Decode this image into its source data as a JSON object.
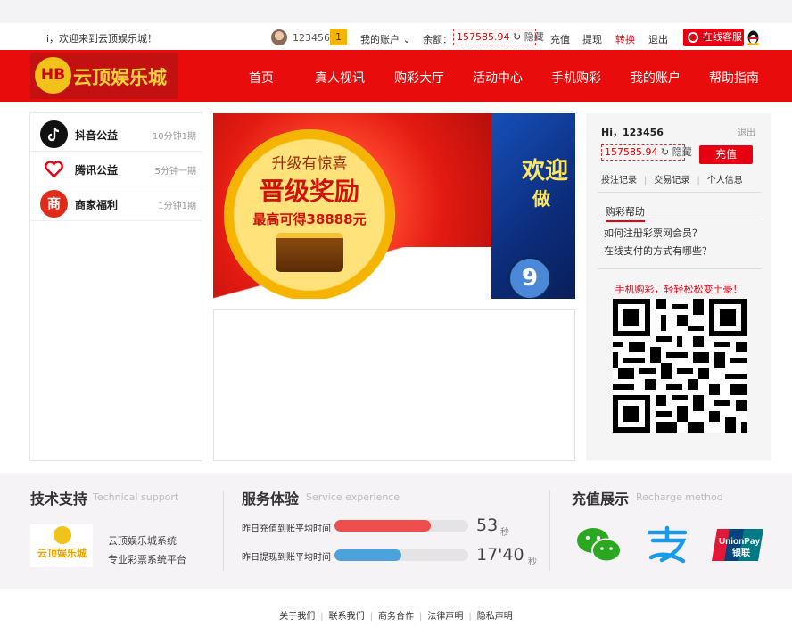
{
  "topbar": {
    "welcome": "i，欢迎来到云顶娱乐城！",
    "username": "123456",
    "level": "1",
    "my_account": "我的账户",
    "balance_label": "余额：",
    "balance": "157585.94",
    "hide": "隐藏",
    "links": [
      "充值",
      "提现",
      "转换",
      "退出"
    ],
    "online_service": "在线客服"
  },
  "nav": {
    "logo_mark": "HB",
    "logo_text": "云顶娱乐城",
    "items": [
      "首页",
      "真人视讯",
      "购彩大厅",
      "活动中心",
      "手机购彩",
      "我的账户",
      "帮助指南"
    ]
  },
  "lottery_list": [
    {
      "name": "抖音公益",
      "freq": "10分钟1期",
      "icon": "douyin-icon",
      "color": "#111111"
    },
    {
      "name": "腾讯公益",
      "freq": "5分钟一期",
      "icon": "heart-icon",
      "color": "#e60012"
    },
    {
      "name": "商家福利",
      "freq": "1分钟1期",
      "icon": "shang-icon",
      "color": "#e02a1a"
    }
  ],
  "banner": {
    "slide1_line1": "升级有惊喜",
    "slide1_line2": "晋级奖励",
    "slide1_line3": "最高可得38888元",
    "slide2_line1": "欢迎",
    "slide2_line2": "做",
    "slide2_ball": "9"
  },
  "account_panel": {
    "greeting": "Hi，123456",
    "logout": "退出",
    "balance": "157585.94",
    "hide": "隐藏",
    "recharge": "充值",
    "links": [
      "投注记录",
      "交易记录",
      "个人信息"
    ],
    "help_title": "购彩帮助",
    "faqs": [
      "如何注册彩票网会员？",
      "在线支付的方式有哪些？"
    ],
    "mobile_slogan": "手机购彩，轻轻松松变土豪！"
  },
  "footer_band": {
    "tech": {
      "title": "技术支持",
      "sub": "Technical support",
      "logo_text": "云顶娱乐城",
      "lines": [
        "云顶娱乐城系统",
        "专业彩票系统平台"
      ]
    },
    "service": {
      "title": "服务体验",
      "sub": "Service experience",
      "metrics": [
        {
          "label": "昨日充值到账平均时间",
          "value": "53",
          "unit": "秒",
          "fill": 0.72,
          "color": "#f04d4d"
        },
        {
          "label": "昨日提现到账平均时间",
          "value": "17'40",
          "unit": "秒",
          "fill": 0.5,
          "color": "#4aa3dc"
        }
      ]
    },
    "pay": {
      "title": "充值展示",
      "sub": "Recharge method",
      "methods": [
        "wechat-pay-icon",
        "alipay-icon",
        "unionpay-icon"
      ],
      "unionpay_text": "UnionPay",
      "unionpay_cn": "银联"
    }
  },
  "bottom_links": [
    "关于我们",
    "联系我们",
    "商务合作",
    "法律声明",
    "隐私声明"
  ],
  "colors": {
    "brand_red": "#e80c0c",
    "gold": "#f7d23a"
  }
}
